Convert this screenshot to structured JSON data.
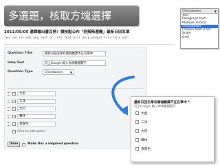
{
  "slide": {
    "title": "多選題，核取方塊選擇"
  },
  "type_menu": {
    "selected": "Checkboxes",
    "items": [
      "Text",
      "Paragraph text",
      "Multiple choice",
      "Checkboxes",
      "Choose from a list",
      "Scale",
      "Grid"
    ]
  },
  "form": {
    "title": "2011/05/05 選課輸出書百熱！標枝點公布「疤殼降瀝機」最新日回名單",
    "description": "You can include any text or info that will help people fill this out.",
    "question_title_label": "Question Title",
    "question_title_value": "最新日回名單有哪個願譯不在名單中",
    "help_text_label": "Help Text",
    "help_text_value": "可上Google 輸入你演機開關字",
    "question_type_label": "Question Type",
    "question_type_value": "Checkboxes",
    "options": [
      "大金",
      "三洋",
      "大同",
      "聲林",
      "香雷色"
    ],
    "add_option_label": "Click to add option",
    "done_label": "Done",
    "required_label": "Make this a required question"
  },
  "preview": {
    "title": "最新日回名單有哪個願譯不在名單中 *",
    "help": "可上Google 輸入你演機開關字",
    "options": [
      "大金",
      "三洋",
      "大同",
      "聲林",
      "香雷色"
    ]
  },
  "colors": {
    "title_bg": "#6f6f6f",
    "selected": "#3a6fd8",
    "arrow": "#2e7fd6"
  }
}
